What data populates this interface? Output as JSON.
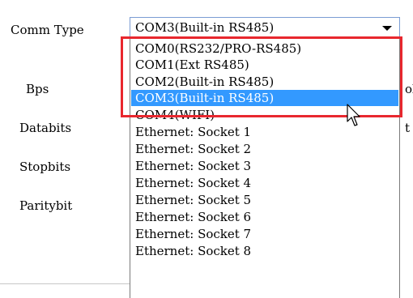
{
  "labels": {
    "comm_type": "Comm Type",
    "bps": "Bps",
    "databits": "Databits",
    "stopbits": "Stopbits",
    "paritybit": "Paritybit"
  },
  "clipped_right": [
    "ol",
    "t"
  ],
  "combo": {
    "value": "COM3(Built-in RS485)",
    "options": [
      "COM0(RS232/PRO-RS485)",
      "COM1(Ext RS485)",
      "COM2(Built-in RS485)",
      "COM3(Built-in RS485)",
      "COM4(WIFI)",
      "Ethernet: Socket 1",
      "Ethernet: Socket 2",
      "Ethernet: Socket 3",
      "Ethernet: Socket 4",
      "Ethernet: Socket 5",
      "Ethernet: Socket 6",
      "Ethernet: Socket 7",
      "Ethernet: Socket 8"
    ],
    "selected_index": 3
  },
  "colors": {
    "selection": "#3399ff",
    "highlight_box": "#e8272e"
  }
}
